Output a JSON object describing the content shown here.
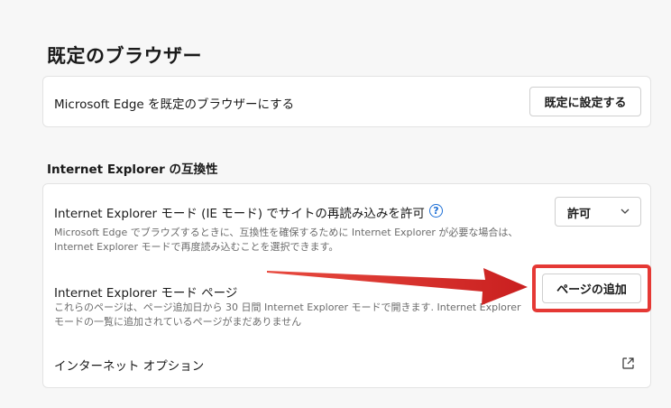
{
  "page": {
    "title": "既定のブラウザー"
  },
  "default_browser": {
    "label": "Microsoft Edge を既定のブラウザーにする",
    "button": "既定に設定する"
  },
  "ie_section": {
    "heading": "Internet Explorer の互換性",
    "reload": {
      "label": "Internet Explorer モード (IE モード) でサイトの再読み込みを許可",
      "help_icon": "?",
      "description_line1": "Microsoft Edge でブラウズするときに、互換性を確保するために Internet Explorer が必要な場合は、",
      "description_line2": "Internet Explorer モードで再度読み込むことを選択できます。",
      "dropdown_value": "許可",
      "dropdown_icon": "chevron-down-icon"
    },
    "ie_pages": {
      "label": "Internet Explorer モード ページ",
      "description_line1": "これらのページは、ページ追加日から 30 日間 Internet Explorer モードで開きます. Internet Explorer",
      "description_line2": "モードの一覧に追加されているページがまだありません",
      "button": "ページの追加"
    },
    "internet_options": {
      "label": "インターネット オプション",
      "icon": "external-link-icon"
    }
  },
  "colors": {
    "highlight": "#e53935",
    "help_accent": "#1d6fd6"
  }
}
